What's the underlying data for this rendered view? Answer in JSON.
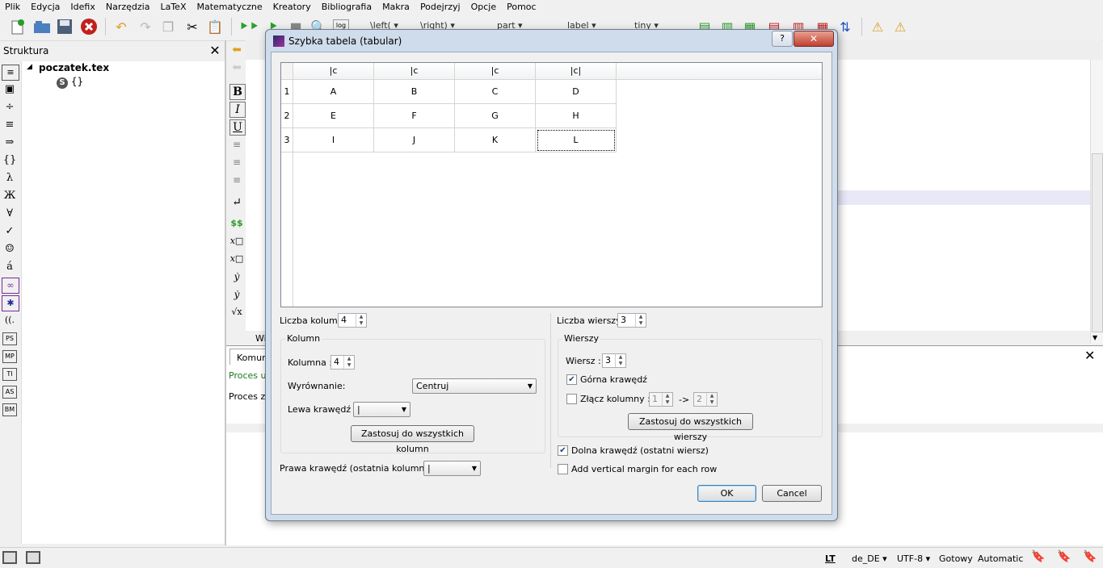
{
  "menu": [
    "Plik",
    "Edycja",
    "Idefix",
    "Narzędzia",
    "LaTeX",
    "Matematyczne",
    "Kreatory",
    "Bibliografia",
    "Makra",
    "Podejrzyj",
    "Opcje",
    "Pomoc"
  ],
  "toolbar": {
    "combos": [
      "\\left(",
      "\\right)",
      "part",
      "label",
      "tiny"
    ],
    "log_label": "log"
  },
  "structure": {
    "title": "Struktura",
    "root": "poczatek.tex",
    "child_icon": "S",
    "child": "{}"
  },
  "left_icons": [
    "≡",
    "▣",
    "÷",
    "≡",
    "⇒",
    "{}",
    "λ",
    "Ж",
    "∀",
    "✓",
    "☺",
    "á",
    "∞",
    "✱",
    "((.",
    "PS",
    "MP",
    "TI",
    "AS",
    "BM"
  ],
  "editor_icons": [
    "B",
    "I",
    "U",
    "$$",
    "x□",
    "x□",
    "ẏ",
    "ẏ",
    "√x"
  ],
  "messages": {
    "tab": "Komuni",
    "line1": "Proces ur",
    "line2": "Proces za",
    "w_label": "Wi"
  },
  "status": {
    "lt": "LT",
    "lang": "de_DE",
    "encoding": "UTF-8",
    "ready": "Gotowy",
    "mode": "Automatic"
  },
  "dialog": {
    "title": "Szybka tabela (tabular)",
    "help": "?",
    "close": "✕",
    "columns_header": [
      "|c",
      "|c",
      "|c",
      "|c|"
    ],
    "rows": [
      {
        "num": "1",
        "cells": [
          "A",
          "B",
          "C",
          "D"
        ]
      },
      {
        "num": "2",
        "cells": [
          "E",
          "F",
          "G",
          "H"
        ]
      },
      {
        "num": "3",
        "cells": [
          "I",
          "J",
          "K",
          "L"
        ]
      }
    ],
    "num_columns_label": "Liczba kolumn",
    "num_columns": "4",
    "num_rows_label": "Liczba wierszy",
    "num_rows": "3",
    "column_group": "Kolumn",
    "column_label": "Kolumna :",
    "column_value": "4",
    "align_label": "Wyrównanie:",
    "align_value": "Centruj",
    "left_border_label": "Lewa krawędź :",
    "left_border_value": "|",
    "apply_columns": "Zastosuj do wszystkich kolumn",
    "right_border_label": "Prawa krawędź (ostatnia kolumna) :",
    "right_border_value": "|",
    "rows_group": "Wierszy",
    "row_label": "Wiersz :",
    "row_value": "3",
    "top_border_label": "Górna krawędź",
    "merge_label": "Złącz kolumny :",
    "merge_from": "1",
    "merge_arrow": "->",
    "merge_to": "2",
    "apply_rows": "Zastosuj do wszystkich wierszy",
    "bottom_border_label": "Dolna krawędź (ostatni wiersz)",
    "vertical_margin_label": "Add vertical margin for each row",
    "ok": "OK",
    "cancel": "Cancel",
    "top_border_checked": true,
    "bottom_border_checked": true
  }
}
